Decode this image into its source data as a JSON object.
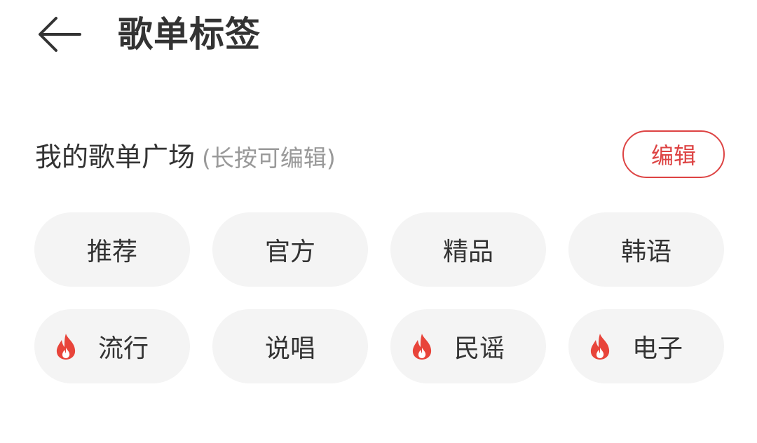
{
  "header": {
    "title": "歌单标签",
    "back_icon": "arrow-left-icon"
  },
  "section": {
    "title": "我的歌单广场",
    "hint": "(长按可编辑)",
    "edit_label": "编辑"
  },
  "colors": {
    "accent": "#dd4343",
    "tag_background": "#f4f4f4",
    "hint_text": "#999999"
  },
  "tags": [
    {
      "label": "推荐",
      "hot": false
    },
    {
      "label": "官方",
      "hot": false
    },
    {
      "label": "精品",
      "hot": false
    },
    {
      "label": "韩语",
      "hot": false
    },
    {
      "label": "流行",
      "hot": true,
      "icon": "fire-icon"
    },
    {
      "label": "说唱",
      "hot": false
    },
    {
      "label": "民谣",
      "hot": true,
      "icon": "fire-icon"
    },
    {
      "label": "电子",
      "hot": true,
      "icon": "fire-icon"
    }
  ]
}
